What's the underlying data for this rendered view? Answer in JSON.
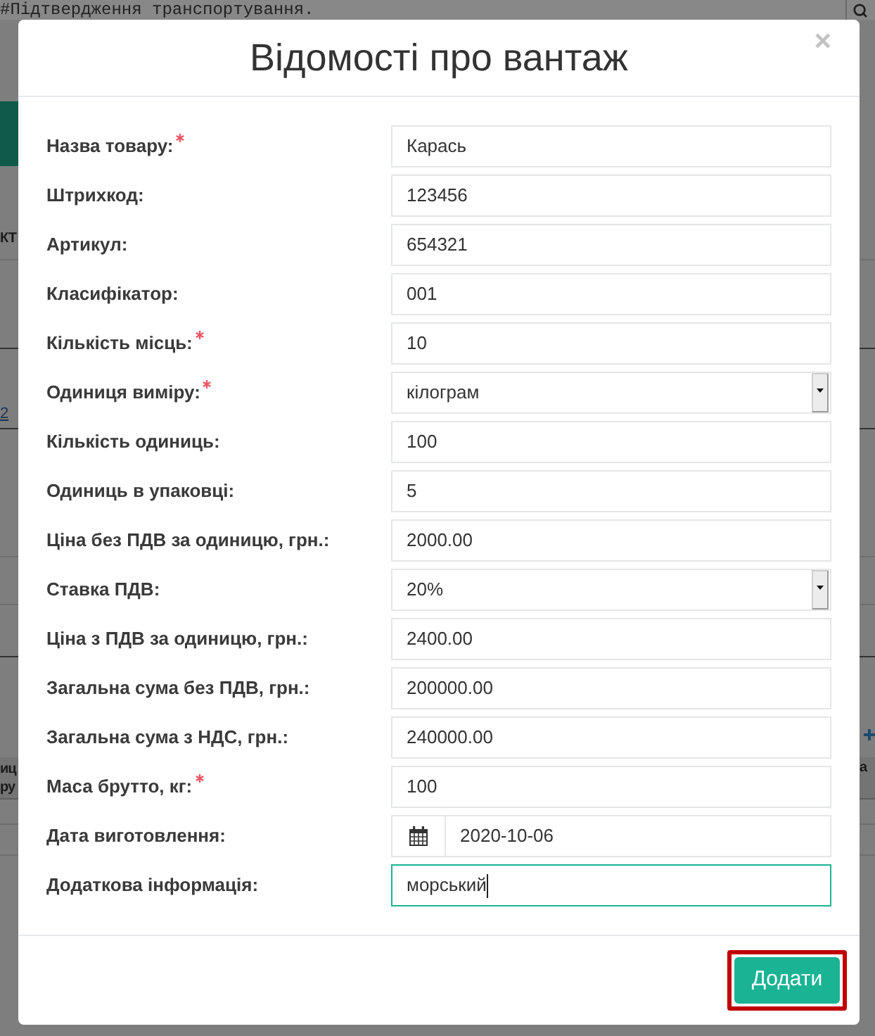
{
  "background_page": {
    "editor_line": "#Підтвердження транспортування.",
    "heading_fragment": "КТ",
    "link_fragment": "2",
    "header_fragment_lines": [
      "иц",
      "ру"
    ],
    "right_fragment": "а"
  },
  "dialog": {
    "title": "Відомості про вантаж",
    "close": "×",
    "fields": [
      {
        "kind": "text",
        "label": "Назва товару:",
        "required": true,
        "value": "Карась",
        "focused": false
      },
      {
        "kind": "text",
        "label": "Штрихкод:",
        "required": false,
        "value": "123456",
        "focused": false
      },
      {
        "kind": "text",
        "label": "Артикул:",
        "required": false,
        "value": "654321",
        "focused": false
      },
      {
        "kind": "text",
        "label": "Класифікатор:",
        "required": false,
        "value": "001",
        "focused": false
      },
      {
        "kind": "text",
        "label": "Кількість місць:",
        "required": true,
        "value": "10",
        "focused": false
      },
      {
        "kind": "select",
        "label": "Одиниця виміру:",
        "required": true,
        "value": "кілограм",
        "focused": false
      },
      {
        "kind": "text",
        "label": "Кількість одиниць:",
        "required": false,
        "value": "100",
        "focused": false
      },
      {
        "kind": "text",
        "label": "Одиниць в упаковці:",
        "required": false,
        "value": "5",
        "focused": false
      },
      {
        "kind": "text",
        "label": "Ціна без ПДВ за одиницю, грн.:",
        "required": false,
        "value": "2000.00",
        "focused": false
      },
      {
        "kind": "select",
        "label": "Ставка ПДВ:",
        "required": false,
        "value": "20%",
        "focused": false
      },
      {
        "kind": "text",
        "label": "Ціна з ПДВ за одиницю, грн.:",
        "required": false,
        "value": "2400.00",
        "focused": false
      },
      {
        "kind": "text",
        "label": "Загальна сума без ПДВ, грн.:",
        "required": false,
        "value": "200000.00",
        "focused": false
      },
      {
        "kind": "text",
        "label": "Загальна сума з НДС, грн.:",
        "required": false,
        "value": "240000.00",
        "focused": false
      },
      {
        "kind": "text",
        "label": "Маса брутто, кг:",
        "required": true,
        "value": "100",
        "focused": false
      },
      {
        "kind": "date",
        "label": "Дата виготовлення:",
        "required": false,
        "value": "2020-10-06",
        "focused": false
      },
      {
        "kind": "text",
        "label": "Додаткова інформація:",
        "required": false,
        "value": "морський",
        "focused": true
      }
    ],
    "submit": {
      "label": "Додати",
      "highlighted": true
    }
  }
}
